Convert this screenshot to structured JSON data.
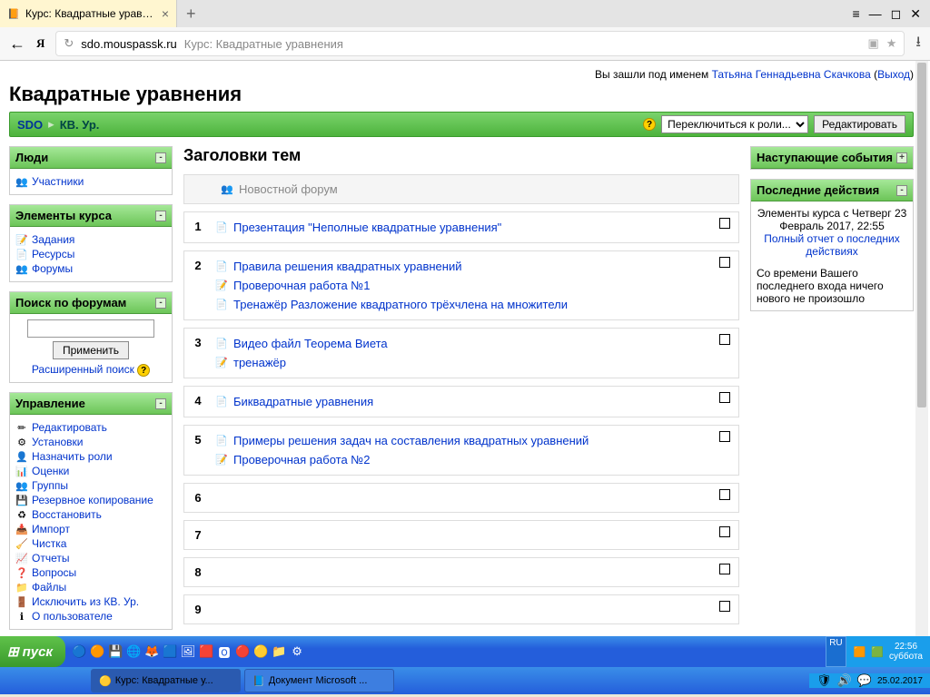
{
  "browser": {
    "tab_title": "Курс: Квадратные уравн...",
    "new_tab": "+",
    "url_host": "sdo.mouspassk.ru",
    "url_rest": "Курс: Квадратные уравнения"
  },
  "login": {
    "prefix": "Вы зашли под именем ",
    "user": "Татьяна Геннадьевна Скачкова",
    "logout": "Выход"
  },
  "course_title": "Квадратные уравнения",
  "breadcrumb": {
    "root": "SDO",
    "current": "КВ. Ур."
  },
  "navbar": {
    "role_select": "Переключиться к роли...",
    "edit": "Редактировать"
  },
  "blocks": {
    "people": {
      "title": "Люди",
      "participants": "Участники"
    },
    "elements": {
      "title": "Элементы курса",
      "items": [
        "Задания",
        "Ресурсы",
        "Форумы"
      ]
    },
    "search": {
      "title": "Поиск по форумам",
      "submit": "Применить",
      "advanced": "Расширенный поиск"
    },
    "admin": {
      "title": "Управление",
      "items": [
        "Редактировать",
        "Установки",
        "Назначить роли",
        "Оценки",
        "Группы",
        "Резервное копирование",
        "Восстановить",
        "Импорт",
        "Чистка",
        "Отчеты",
        "Вопросы",
        "Файлы",
        "Исключить из КВ. Ур.",
        "О пользователе"
      ]
    },
    "upcoming": {
      "title": "Наступающие события"
    },
    "recent": {
      "title": "Последние действия",
      "line1": "Элементы курса с Четверг 23 Февраль 2017, 22:55",
      "report": "Полный отчет о последних действиях",
      "nothing": "Со времени Вашего последнего входа ничего нового не произошло"
    }
  },
  "topics": {
    "heading": "Заголовки тем",
    "news": "Новостной форум",
    "sections": [
      {
        "num": "1",
        "items": [
          "Презентация \"Неполные квадратные уравнения\""
        ]
      },
      {
        "num": "2",
        "items": [
          "Правила решения квадратных уравнений",
          "Проверочная работа №1",
          "Тренажёр Разложение квадратного трёхчлена на множители"
        ]
      },
      {
        "num": "3",
        "items": [
          "Видео файл Теорема Виета",
          "тренажёр"
        ]
      },
      {
        "num": "4",
        "items": [
          "Биквадратные уравнения"
        ]
      },
      {
        "num": "5",
        "items": [
          "Примеры решения задач на составления квадратных уравнений",
          "Проверочная работа №2"
        ]
      },
      {
        "num": "6",
        "items": []
      },
      {
        "num": "7",
        "items": []
      },
      {
        "num": "8",
        "items": []
      },
      {
        "num": "9",
        "items": []
      }
    ]
  },
  "taskbar": {
    "start": "пуск",
    "items": [
      "Курс: Квадратные у...",
      "Документ Microsoft ..."
    ],
    "lang": "RU",
    "time": "22:56",
    "day": "суббота",
    "date": "25.02.2017"
  }
}
